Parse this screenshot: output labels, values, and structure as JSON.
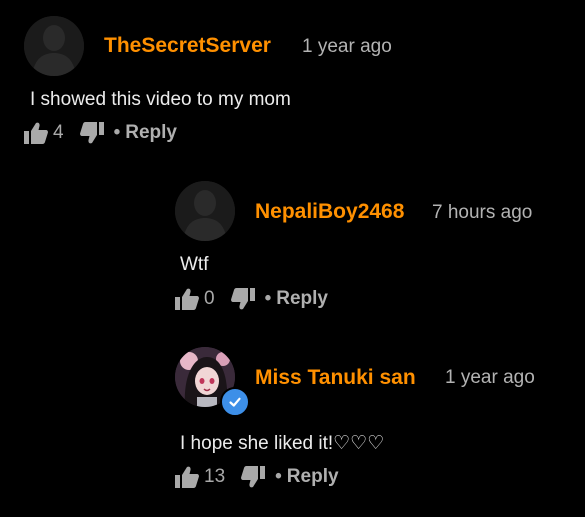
{
  "colors": {
    "username": "#ff9000",
    "background": "#000000",
    "verified_badge": "#3d8fe8"
  },
  "comments": [
    {
      "username": "TheSecretServer",
      "time": "1 year ago",
      "text": "I showed this video to my mom",
      "likes": "4",
      "reply_label": "Reply",
      "separator": "•"
    },
    {
      "username": "NepaliBoy2468",
      "time": "7 hours ago",
      "text": "Wtf",
      "likes": "0",
      "reply_label": "Reply",
      "separator": "•"
    },
    {
      "username": "Miss Tanuki san",
      "time": "1 year ago",
      "text": "I hope she liked it!♡♡♡",
      "likes": "13",
      "reply_label": "Reply",
      "separator": "•",
      "verified": true
    }
  ]
}
